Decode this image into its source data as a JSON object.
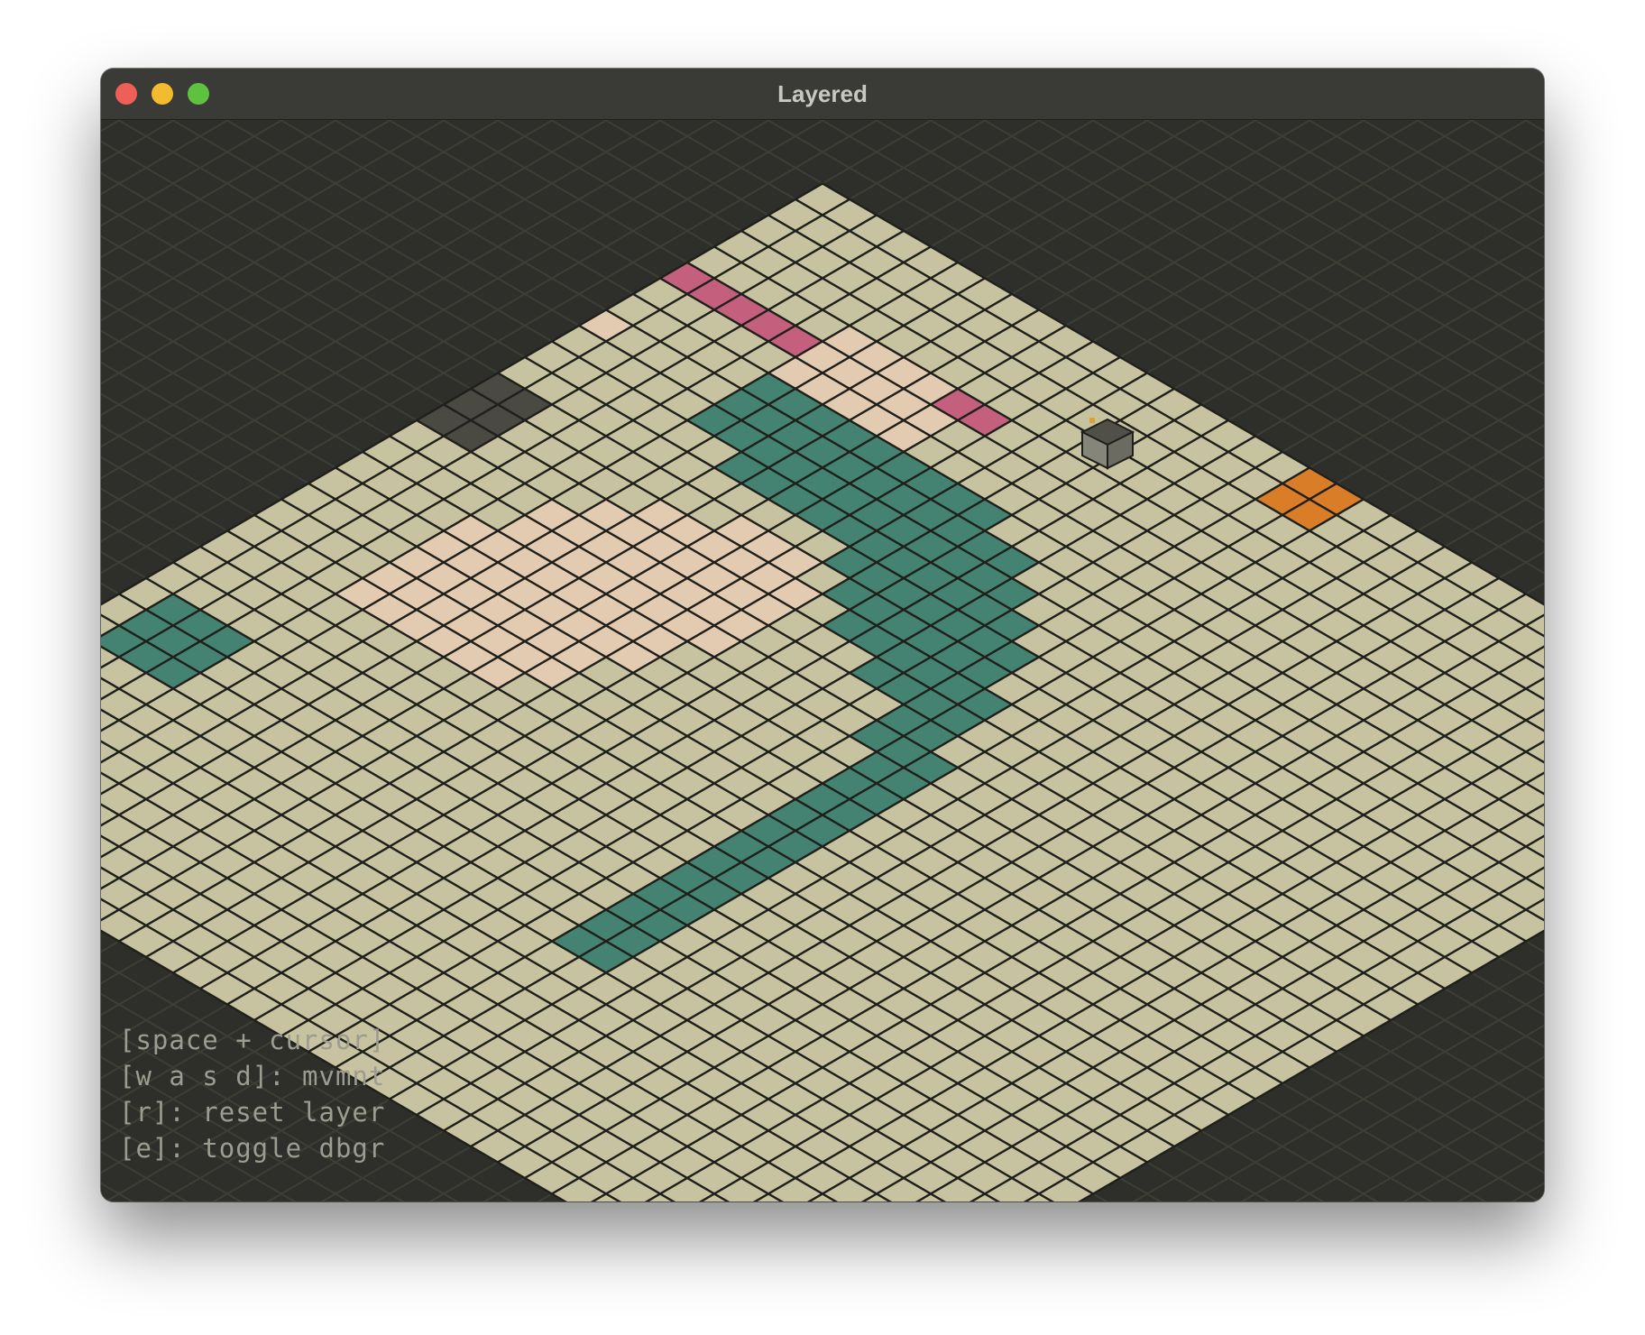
{
  "window": {
    "title": "Layered"
  },
  "help": {
    "lines": [
      "[space + cursor]",
      "[w a s d]: mvmnt",
      "[r]: reset layer",
      "[e]: toggle dbgr"
    ]
  },
  "palette": {
    "grass": "#c7c3a0",
    "grid": "#1f201c",
    "path_pink": "#c4607e",
    "sand": "#e3cbb1",
    "stone": "#4a4a42",
    "water": "#448371",
    "orange": "#d97d28",
    "void": "#2e2f2a"
  },
  "player": {
    "icon": "cube-character-icon",
    "col": 56,
    "row": 4
  }
}
